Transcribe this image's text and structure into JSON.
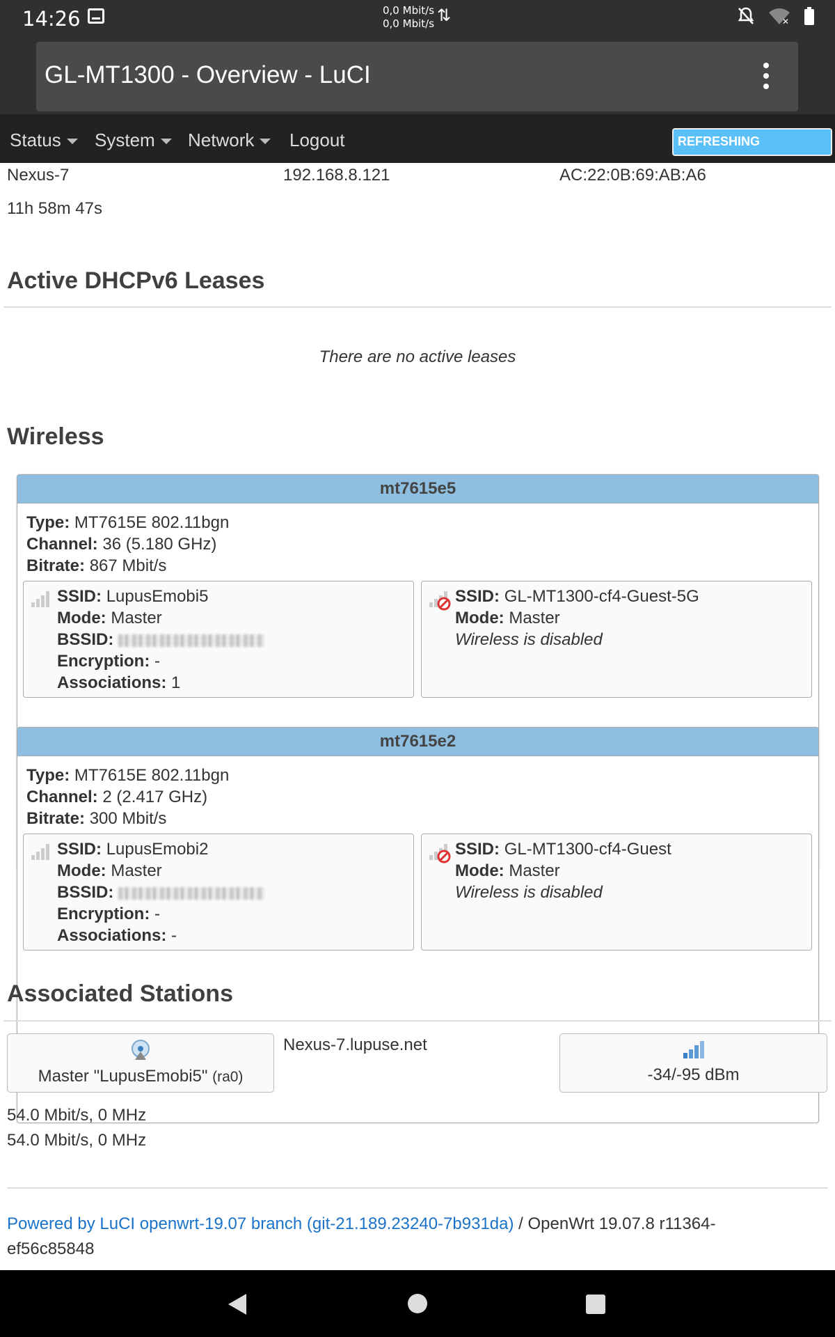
{
  "statusbar": {
    "time": "14:26",
    "speed_up": "0,0 Mbit/s",
    "speed_down": "0,0 Mbit/s"
  },
  "browser": {
    "title": "GL-MT1300 - Overview - LuCI"
  },
  "menu": {
    "items": [
      {
        "label": "Status"
      },
      {
        "label": "System"
      },
      {
        "label": "Network"
      },
      {
        "label": "Logout"
      }
    ],
    "refresh_label": "REFRESHING"
  },
  "dhcp_lease": {
    "hostname": "Nexus-7",
    "ip": "192.168.8.121",
    "mac": "AC:22:0B:69:AB:A6",
    "lease_time": "11h 58m 47s"
  },
  "dhcpv6": {
    "heading": "Active DHCPv6 Leases",
    "empty_text": "There are no active leases"
  },
  "wireless": {
    "heading": "Wireless",
    "radios": [
      {
        "name": "mt7615e5",
        "type_label": "Type:",
        "type": "MT7615E 802.11bgn",
        "channel_label": "Channel:",
        "channel": "36 (5.180 GHz)",
        "bitrate_label": "Bitrate:",
        "bitrate": "867 Mbit/s",
        "networks": [
          {
            "ssid_label": "SSID:",
            "ssid": "LupusEmobi5",
            "mode_label": "Mode:",
            "mode": "Master",
            "bssid_label": "BSSID:",
            "encryption_label": "Encryption:",
            "encryption": "-",
            "associations_label": "Associations:",
            "associations": "1",
            "icon": "signal-icon"
          },
          {
            "ssid_label": "SSID:",
            "ssid": "GL-MT1300-cf4-Guest-5G",
            "mode_label": "Mode:",
            "mode": "Master",
            "status": "Wireless is disabled",
            "icon": "signal-disabled-icon"
          }
        ]
      },
      {
        "name": "mt7615e2",
        "type_label": "Type:",
        "type": "MT7615E 802.11bgn",
        "channel_label": "Channel:",
        "channel": "2 (2.417 GHz)",
        "bitrate_label": "Bitrate:",
        "bitrate": "300 Mbit/s",
        "networks": [
          {
            "ssid_label": "SSID:",
            "ssid": "LupusEmobi2",
            "mode_label": "Mode:",
            "mode": "Master",
            "bssid_label": "BSSID:",
            "encryption_label": "Encryption:",
            "encryption": "-",
            "associations_label": "Associations:",
            "associations": "-",
            "icon": "signal-icon"
          },
          {
            "ssid_label": "SSID:",
            "ssid": "GL-MT1300-cf4-Guest",
            "mode_label": "Mode:",
            "mode": "Master",
            "status": "Wireless is disabled",
            "icon": "signal-disabled-icon"
          }
        ]
      }
    ]
  },
  "stations": {
    "heading": "Associated Stations",
    "network": "Master \"LupusEmobi5\"",
    "interface": "(ra0)",
    "hostname": "Nexus-7.lupuse.net",
    "signal": "-34/-95 dBm",
    "rx_rate": "54.0 Mbit/s, 0 MHz",
    "tx_rate": "54.0 Mbit/s, 0 MHz"
  },
  "footer": {
    "link": "Powered by LuCI openwrt-19.07 branch (git-21.189.23240-7b931da)",
    "separator": " / ",
    "version_line1": "OpenWrt 19.07.8 r11364-",
    "version_line2": "ef56c85848"
  },
  "colors": {
    "accent": "#5bc0f8",
    "card_header": "#8fbfe0",
    "link": "#1a73c9"
  }
}
